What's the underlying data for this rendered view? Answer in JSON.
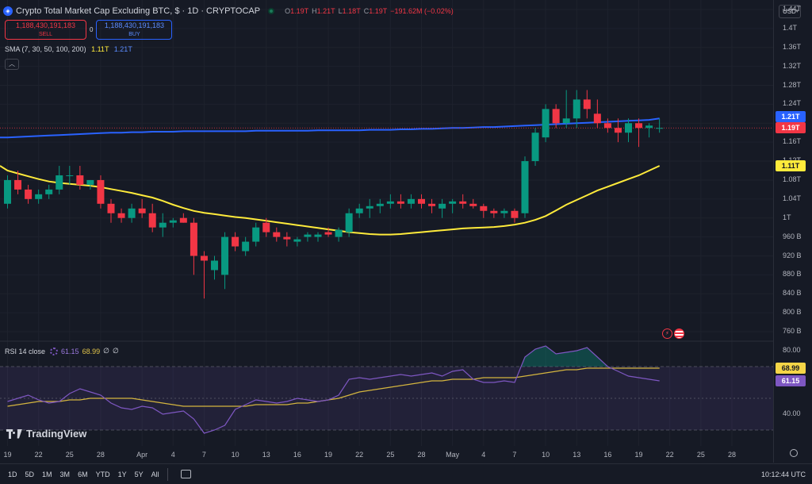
{
  "header": {
    "title": "Crypto Total Market Cap Excluding BTC, $ · 1D · CRYPTOCAP",
    "ohlc": [
      {
        "k": "O",
        "v": "1.19T"
      },
      {
        "k": "H",
        "v": "1.21T"
      },
      {
        "k": "L",
        "v": "1.18T"
      },
      {
        "k": "C",
        "v": "1.19T"
      },
      {
        "k": "",
        "v": "−191.62M (−0.02%)"
      }
    ],
    "currency": "USD"
  },
  "trade": {
    "sell_value": "1,188,430,191,183",
    "sell_label": "SELL",
    "spread": "0",
    "buy_value": "1,188,430,191,183",
    "buy_label": "BUY"
  },
  "sma_legend": {
    "label": "SMA (7, 30, 50, 100, 200)",
    "v1": "1.11T",
    "v2": "1.21T"
  },
  "rsi_legend": {
    "label": "RSI 14 close",
    "v1": "61.15",
    "v2": "68.99",
    "v3": "∅",
    "v4": "∅"
  },
  "brand": "TradingView",
  "price_axis": [
    "1.44T",
    "1.4T",
    "1.36T",
    "1.32T",
    "1.28T",
    "1.24T",
    "1.2T",
    "1.16T",
    "1.12T",
    "1.08T",
    "1.04T",
    "1T",
    "960 B",
    "920 B",
    "880 B",
    "840 B",
    "800 B",
    "760 B"
  ],
  "price_badges": {
    "sma200": "1.21T",
    "last": "1.19T",
    "sma50": "1.11T"
  },
  "rsi_axis": [
    "80.00",
    "40.00"
  ],
  "rsi_badges": {
    "ma": "68.99",
    "rsi": "61.15"
  },
  "time_axis": [
    {
      "label": "19",
      "x": 0
    },
    {
      "label": "22",
      "x": 3
    },
    {
      "label": "25",
      "x": 6
    },
    {
      "label": "28",
      "x": 9
    },
    {
      "label": "Apr",
      "x": 13
    },
    {
      "label": "4",
      "x": 16
    },
    {
      "label": "7",
      "x": 19
    },
    {
      "label": "10",
      "x": 22
    },
    {
      "label": "13",
      "x": 25
    },
    {
      "label": "16",
      "x": 28
    },
    {
      "label": "19",
      "x": 31
    },
    {
      "label": "22",
      "x": 34
    },
    {
      "label": "25",
      "x": 37
    },
    {
      "label": "28",
      "x": 40
    },
    {
      "label": "May",
      "x": 43
    },
    {
      "label": "4",
      "x": 46
    },
    {
      "label": "7",
      "x": 49
    },
    {
      "label": "10",
      "x": 52
    },
    {
      "label": "13",
      "x": 55
    },
    {
      "label": "16",
      "x": 58
    },
    {
      "label": "19",
      "x": 61
    },
    {
      "label": "22",
      "x": 64
    },
    {
      "label": "25",
      "x": 67
    },
    {
      "label": "28",
      "x": 70
    }
  ],
  "ranges": [
    "1D",
    "5D",
    "1M",
    "3M",
    "6M",
    "YTD",
    "1Y",
    "5Y",
    "All"
  ],
  "clock": "10:12:44 UTC",
  "colors": {
    "up": "#089981",
    "down": "#f23645",
    "sma200": "#2962ff",
    "sma50": "#ffeb3b",
    "rsi": "#7e57c2",
    "rsi_ma": "#d4b53f"
  },
  "chart_data": {
    "type": "candlestick",
    "price_unit": "USD",
    "candles": [
      {
        "o": 1.03,
        "h": 1.09,
        "l": 1.02,
        "c": 1.08
      },
      {
        "o": 1.08,
        "h": 1.1,
        "l": 1.05,
        "c": 1.06
      },
      {
        "o": 1.06,
        "h": 1.07,
        "l": 1.03,
        "c": 1.04
      },
      {
        "o": 1.04,
        "h": 1.06,
        "l": 1.03,
        "c": 1.05
      },
      {
        "o": 1.05,
        "h": 1.07,
        "l": 1.04,
        "c": 1.06
      },
      {
        "o": 1.06,
        "h": 1.11,
        "l": 1.05,
        "c": 1.09
      },
      {
        "o": 1.09,
        "h": 1.11,
        "l": 1.07,
        "c": 1.09
      },
      {
        "o": 1.09,
        "h": 1.11,
        "l": 1.06,
        "c": 1.07
      },
      {
        "o": 1.07,
        "h": 1.08,
        "l": 1.06,
        "c": 1.08
      },
      {
        "o": 1.08,
        "h": 1.09,
        "l": 1.02,
        "c": 1.03
      },
      {
        "o": 1.03,
        "h": 1.04,
        "l": 0.99,
        "c": 1.01
      },
      {
        "o": 1.01,
        "h": 1.02,
        "l": 0.99,
        "c": 1.0
      },
      {
        "o": 1.0,
        "h": 1.03,
        "l": 0.99,
        "c": 1.02
      },
      {
        "o": 1.02,
        "h": 1.04,
        "l": 1.0,
        "c": 1.01
      },
      {
        "o": 1.01,
        "h": 1.03,
        "l": 0.97,
        "c": 0.98
      },
      {
        "o": 0.98,
        "h": 1.01,
        "l": 0.96,
        "c": 0.99
      },
      {
        "o": 0.99,
        "h": 1.0,
        "l": 0.98,
        "c": 0.995
      },
      {
        "o": 1.0,
        "h": 1.01,
        "l": 0.99,
        "c": 0.99
      },
      {
        "o": 0.99,
        "h": 1.0,
        "l": 0.88,
        "c": 0.92
      },
      {
        "o": 0.92,
        "h": 0.93,
        "l": 0.83,
        "c": 0.91
      },
      {
        "o": 0.89,
        "h": 0.92,
        "l": 0.87,
        "c": 0.91
      },
      {
        "o": 0.88,
        "h": 0.97,
        "l": 0.85,
        "c": 0.96
      },
      {
        "o": 0.96,
        "h": 0.97,
        "l": 0.93,
        "c": 0.94
      },
      {
        "o": 0.93,
        "h": 0.96,
        "l": 0.92,
        "c": 0.95
      },
      {
        "o": 0.95,
        "h": 0.99,
        "l": 0.94,
        "c": 0.98
      },
      {
        "o": 0.99,
        "h": 1.0,
        "l": 0.96,
        "c": 0.97
      },
      {
        "o": 0.97,
        "h": 0.98,
        "l": 0.95,
        "c": 0.96
      },
      {
        "o": 0.96,
        "h": 0.97,
        "l": 0.94,
        "c": 0.955
      },
      {
        "o": 0.95,
        "h": 0.96,
        "l": 0.94,
        "c": 0.955
      },
      {
        "o": 0.96,
        "h": 0.97,
        "l": 0.95,
        "c": 0.965
      },
      {
        "o": 0.96,
        "h": 0.97,
        "l": 0.95,
        "c": 0.965
      },
      {
        "o": 0.97,
        "h": 0.98,
        "l": 0.96,
        "c": 0.965
      },
      {
        "o": 0.96,
        "h": 0.98,
        "l": 0.95,
        "c": 0.975
      },
      {
        "o": 0.97,
        "h": 1.02,
        "l": 0.96,
        "c": 1.01
      },
      {
        "o": 1.01,
        "h": 1.03,
        "l": 1.0,
        "c": 1.02
      },
      {
        "o": 1.02,
        "h": 1.04,
        "l": 1.0,
        "c": 1.025
      },
      {
        "o": 1.025,
        "h": 1.04,
        "l": 1.01,
        "c": 1.03
      },
      {
        "o": 1.03,
        "h": 1.05,
        "l": 1.02,
        "c": 1.035
      },
      {
        "o": 1.035,
        "h": 1.05,
        "l": 1.02,
        "c": 1.03
      },
      {
        "o": 1.03,
        "h": 1.05,
        "l": 1.02,
        "c": 1.04
      },
      {
        "o": 1.04,
        "h": 1.05,
        "l": 1.02,
        "c": 1.03
      },
      {
        "o": 1.03,
        "h": 1.04,
        "l": 1.01,
        "c": 1.025
      },
      {
        "o": 1.02,
        "h": 1.04,
        "l": 1.0,
        "c": 1.03
      },
      {
        "o": 1.03,
        "h": 1.04,
        "l": 1.01,
        "c": 1.035
      },
      {
        "o": 1.035,
        "h": 1.05,
        "l": 1.02,
        "c": 1.03
      },
      {
        "o": 1.03,
        "h": 1.04,
        "l": 1.02,
        "c": 1.025
      },
      {
        "o": 1.025,
        "h": 1.03,
        "l": 1.0,
        "c": 1.015
      },
      {
        "o": 1.015,
        "h": 1.02,
        "l": 1.0,
        "c": 1.01
      },
      {
        "o": 1.01,
        "h": 1.02,
        "l": 1.0,
        "c": 1.015
      },
      {
        "o": 1.015,
        "h": 1.02,
        "l": 0.99,
        "c": 1.0
      },
      {
        "o": 1.01,
        "h": 1.13,
        "l": 1.0,
        "c": 1.12
      },
      {
        "o": 1.12,
        "h": 1.19,
        "l": 1.11,
        "c": 1.18
      },
      {
        "o": 1.17,
        "h": 1.24,
        "l": 1.16,
        "c": 1.23
      },
      {
        "o": 1.23,
        "h": 1.24,
        "l": 1.19,
        "c": 1.2
      },
      {
        "o": 1.2,
        "h": 1.27,
        "l": 1.19,
        "c": 1.21
      },
      {
        "o": 1.21,
        "h": 1.27,
        "l": 1.19,
        "c": 1.25
      },
      {
        "o": 1.25,
        "h": 1.27,
        "l": 1.21,
        "c": 1.23
      },
      {
        "o": 1.22,
        "h": 1.25,
        "l": 1.19,
        "c": 1.2
      },
      {
        "o": 1.2,
        "h": 1.21,
        "l": 1.18,
        "c": 1.19
      },
      {
        "o": 1.19,
        "h": 1.21,
        "l": 1.16,
        "c": 1.18
      },
      {
        "o": 1.18,
        "h": 1.21,
        "l": 1.16,
        "c": 1.2
      },
      {
        "o": 1.2,
        "h": 1.21,
        "l": 1.15,
        "c": 1.19
      },
      {
        "o": 1.19,
        "h": 1.2,
        "l": 1.17,
        "c": 1.195
      },
      {
        "o": 1.19,
        "h": 1.21,
        "l": 1.18,
        "c": 1.19
      }
    ],
    "sma200": [
      1.17,
      1.171,
      1.172,
      1.173,
      1.174,
      1.175,
      1.176,
      1.177,
      1.178,
      1.179,
      1.18,
      1.18,
      1.181,
      1.181,
      1.182,
      1.182,
      1.182,
      1.183,
      1.183,
      1.183,
      1.183,
      1.183,
      1.183,
      1.183,
      1.184,
      1.184,
      1.184,
      1.184,
      1.184,
      1.184,
      1.185,
      1.185,
      1.185,
      1.185,
      1.185,
      1.186,
      1.186,
      1.186,
      1.187,
      1.187,
      1.188,
      1.188,
      1.189,
      1.19,
      1.19,
      1.191,
      1.192,
      1.192,
      1.193,
      1.194,
      1.195,
      1.196,
      1.197,
      1.198,
      1.199,
      1.2,
      1.201,
      1.202,
      1.203,
      1.204,
      1.205,
      1.206,
      1.207,
      1.21
    ],
    "sma50": [
      1.1,
      1.094,
      1.088,
      1.082,
      1.077,
      1.074,
      1.072,
      1.07,
      1.068,
      1.065,
      1.061,
      1.057,
      1.053,
      1.048,
      1.043,
      1.036,
      1.028,
      1.021,
      1.015,
      1.011,
      1.008,
      1.005,
      1.002,
      1.0,
      0.997,
      0.994,
      0.991,
      0.988,
      0.985,
      0.982,
      0.979,
      0.976,
      0.973,
      0.97,
      0.968,
      0.966,
      0.965,
      0.965,
      0.966,
      0.968,
      0.97,
      0.972,
      0.974,
      0.976,
      0.978,
      0.979,
      0.98,
      0.981,
      0.983,
      0.986,
      0.99,
      0.996,
      1.004,
      1.016,
      1.028,
      1.038,
      1.048,
      1.058,
      1.066,
      1.074,
      1.082,
      1.09,
      1.1,
      1.11
    ],
    "rsi": [
      48,
      50,
      52,
      49,
      47,
      48,
      53,
      56,
      54,
      52,
      47,
      44,
      43,
      45,
      44,
      40,
      41,
      42,
      37,
      28,
      30,
      33,
      43,
      46,
      49,
      48,
      47,
      48,
      50,
      49,
      48,
      49,
      52,
      62,
      63,
      62,
      63,
      64,
      65,
      64,
      65,
      66,
      64,
      67,
      68,
      62,
      60,
      60,
      61,
      60,
      76,
      81,
      83,
      78,
      79,
      80,
      82,
      76,
      70,
      67,
      64,
      63,
      62,
      61
    ],
    "rsi_ma": [
      45,
      46,
      47,
      48,
      48,
      48,
      49,
      49,
      50,
      50,
      50,
      50,
      50,
      49,
      48,
      47,
      46,
      45,
      45,
      45,
      45,
      45,
      45,
      45,
      46,
      46,
      46,
      46,
      47,
      47,
      48,
      49,
      50,
      52,
      54,
      55,
      56,
      57,
      58,
      59,
      60,
      61,
      61,
      62,
      62,
      62,
      63,
      63,
      63,
      63,
      64,
      65,
      66,
      67,
      68,
      68,
      69,
      69,
      69,
      69,
      69,
      69,
      69,
      69
    ],
    "rsi_bands": [
      70,
      30
    ],
    "ylim_price": [
      0.74,
      1.46
    ],
    "ylim_rsi": [
      20,
      85
    ]
  }
}
